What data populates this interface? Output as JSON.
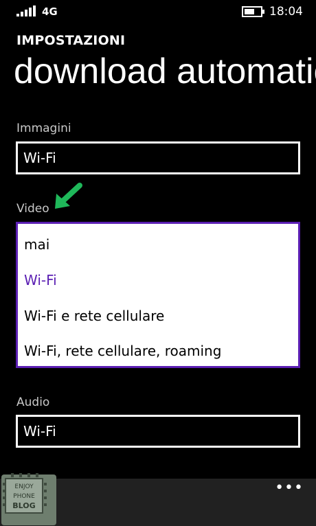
{
  "status": {
    "network": "4G",
    "time": "18:04",
    "signal_icon": "signal-bars-icon",
    "battery_icon": "battery-icon"
  },
  "header": {
    "app_title": "IMPOSTAZIONI",
    "page_title": "download automatici"
  },
  "fields": {
    "images": {
      "label": "Immagini",
      "value": "Wi-Fi"
    },
    "video": {
      "label": "Video",
      "options": [
        "mai",
        "Wi-Fi",
        "Wi-Fi e rete cellulare",
        "Wi-Fi, rete cellulare, roaming"
      ],
      "selected": "Wi-Fi"
    },
    "audio": {
      "label": "Audio",
      "value": "Wi-Fi"
    }
  },
  "appbar": {
    "more_label": "•••"
  },
  "watermark": {
    "line1": "ENJOY",
    "line2": "PHONE",
    "line3": "BLOG"
  },
  "colors": {
    "accent": "#5b1fb3",
    "arrow": "#1fb85a",
    "background": "#000000"
  }
}
